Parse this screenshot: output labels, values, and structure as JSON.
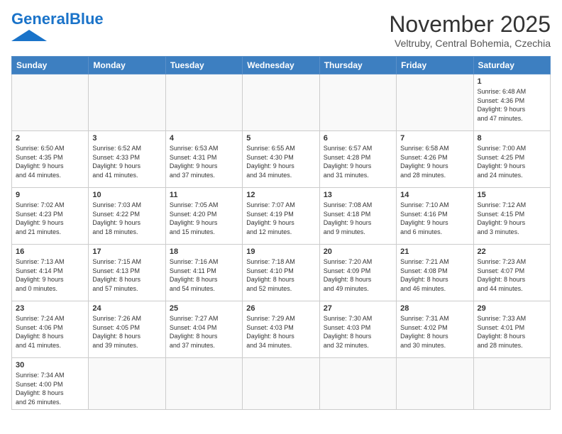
{
  "header": {
    "logo_general": "General",
    "logo_blue": "Blue",
    "title": "November 2025",
    "subtitle": "Veltruby, Central Bohemia, Czechia"
  },
  "days_of_week": [
    "Sunday",
    "Monday",
    "Tuesday",
    "Wednesday",
    "Thursday",
    "Friday",
    "Saturday"
  ],
  "weeks": [
    [
      {
        "day": "",
        "info": ""
      },
      {
        "day": "",
        "info": ""
      },
      {
        "day": "",
        "info": ""
      },
      {
        "day": "",
        "info": ""
      },
      {
        "day": "",
        "info": ""
      },
      {
        "day": "",
        "info": ""
      },
      {
        "day": "1",
        "info": "Sunrise: 6:48 AM\nSunset: 4:36 PM\nDaylight: 9 hours\nand 47 minutes."
      }
    ],
    [
      {
        "day": "2",
        "info": "Sunrise: 6:50 AM\nSunset: 4:35 PM\nDaylight: 9 hours\nand 44 minutes."
      },
      {
        "day": "3",
        "info": "Sunrise: 6:52 AM\nSunset: 4:33 PM\nDaylight: 9 hours\nand 41 minutes."
      },
      {
        "day": "4",
        "info": "Sunrise: 6:53 AM\nSunset: 4:31 PM\nDaylight: 9 hours\nand 37 minutes."
      },
      {
        "day": "5",
        "info": "Sunrise: 6:55 AM\nSunset: 4:30 PM\nDaylight: 9 hours\nand 34 minutes."
      },
      {
        "day": "6",
        "info": "Sunrise: 6:57 AM\nSunset: 4:28 PM\nDaylight: 9 hours\nand 31 minutes."
      },
      {
        "day": "7",
        "info": "Sunrise: 6:58 AM\nSunset: 4:26 PM\nDaylight: 9 hours\nand 28 minutes."
      },
      {
        "day": "8",
        "info": "Sunrise: 7:00 AM\nSunset: 4:25 PM\nDaylight: 9 hours\nand 24 minutes."
      }
    ],
    [
      {
        "day": "9",
        "info": "Sunrise: 7:02 AM\nSunset: 4:23 PM\nDaylight: 9 hours\nand 21 minutes."
      },
      {
        "day": "10",
        "info": "Sunrise: 7:03 AM\nSunset: 4:22 PM\nDaylight: 9 hours\nand 18 minutes."
      },
      {
        "day": "11",
        "info": "Sunrise: 7:05 AM\nSunset: 4:20 PM\nDaylight: 9 hours\nand 15 minutes."
      },
      {
        "day": "12",
        "info": "Sunrise: 7:07 AM\nSunset: 4:19 PM\nDaylight: 9 hours\nand 12 minutes."
      },
      {
        "day": "13",
        "info": "Sunrise: 7:08 AM\nSunset: 4:18 PM\nDaylight: 9 hours\nand 9 minutes."
      },
      {
        "day": "14",
        "info": "Sunrise: 7:10 AM\nSunset: 4:16 PM\nDaylight: 9 hours\nand 6 minutes."
      },
      {
        "day": "15",
        "info": "Sunrise: 7:12 AM\nSunset: 4:15 PM\nDaylight: 9 hours\nand 3 minutes."
      }
    ],
    [
      {
        "day": "16",
        "info": "Sunrise: 7:13 AM\nSunset: 4:14 PM\nDaylight: 9 hours\nand 0 minutes."
      },
      {
        "day": "17",
        "info": "Sunrise: 7:15 AM\nSunset: 4:13 PM\nDaylight: 8 hours\nand 57 minutes."
      },
      {
        "day": "18",
        "info": "Sunrise: 7:16 AM\nSunset: 4:11 PM\nDaylight: 8 hours\nand 54 minutes."
      },
      {
        "day": "19",
        "info": "Sunrise: 7:18 AM\nSunset: 4:10 PM\nDaylight: 8 hours\nand 52 minutes."
      },
      {
        "day": "20",
        "info": "Sunrise: 7:20 AM\nSunset: 4:09 PM\nDaylight: 8 hours\nand 49 minutes."
      },
      {
        "day": "21",
        "info": "Sunrise: 7:21 AM\nSunset: 4:08 PM\nDaylight: 8 hours\nand 46 minutes."
      },
      {
        "day": "22",
        "info": "Sunrise: 7:23 AM\nSunset: 4:07 PM\nDaylight: 8 hours\nand 44 minutes."
      }
    ],
    [
      {
        "day": "23",
        "info": "Sunrise: 7:24 AM\nSunset: 4:06 PM\nDaylight: 8 hours\nand 41 minutes."
      },
      {
        "day": "24",
        "info": "Sunrise: 7:26 AM\nSunset: 4:05 PM\nDaylight: 8 hours\nand 39 minutes."
      },
      {
        "day": "25",
        "info": "Sunrise: 7:27 AM\nSunset: 4:04 PM\nDaylight: 8 hours\nand 37 minutes."
      },
      {
        "day": "26",
        "info": "Sunrise: 7:29 AM\nSunset: 4:03 PM\nDaylight: 8 hours\nand 34 minutes."
      },
      {
        "day": "27",
        "info": "Sunrise: 7:30 AM\nSunset: 4:03 PM\nDaylight: 8 hours\nand 32 minutes."
      },
      {
        "day": "28",
        "info": "Sunrise: 7:31 AM\nSunset: 4:02 PM\nDaylight: 8 hours\nand 30 minutes."
      },
      {
        "day": "29",
        "info": "Sunrise: 7:33 AM\nSunset: 4:01 PM\nDaylight: 8 hours\nand 28 minutes."
      }
    ],
    [
      {
        "day": "30",
        "info": "Sunrise: 7:34 AM\nSunset: 4:00 PM\nDaylight: 8 hours\nand 26 minutes."
      },
      {
        "day": "",
        "info": ""
      },
      {
        "day": "",
        "info": ""
      },
      {
        "day": "",
        "info": ""
      },
      {
        "day": "",
        "info": ""
      },
      {
        "day": "",
        "info": ""
      },
      {
        "day": "",
        "info": ""
      }
    ]
  ]
}
